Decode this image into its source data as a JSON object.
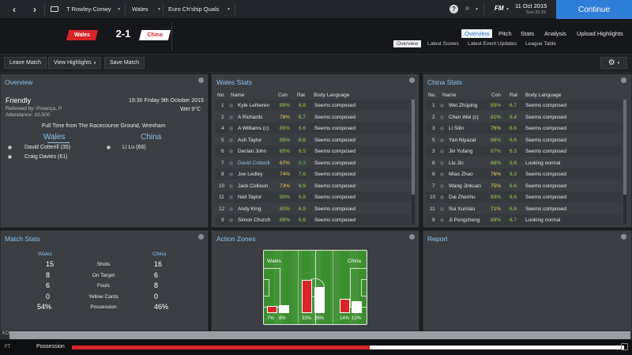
{
  "colors": {
    "accent": "#2f7fd8",
    "title_blue": "#8ec2f0",
    "wales_red": "#d9252a",
    "china_white": "#ffffff",
    "china_text": "#d9252a",
    "good": "#f0d84a",
    "pct_green": "#9fd44a",
    "very_good": "#5fc04a"
  },
  "topbar": {
    "back_icon": "chevron-left-icon",
    "forward_icon": "chevron-right-icon",
    "manager": "T Rowley-Conwy",
    "nation": "Wales",
    "competition": "Euro Ch'ship Quals",
    "date": "11 Oct 2015",
    "day_time": "Sun 21:15",
    "fm_label": "FM",
    "continue": "Continue"
  },
  "header": {
    "home_team": "Wales",
    "away_team": "China",
    "score": "2-1",
    "tabs": [
      "Overview",
      "Pitch",
      "Stats",
      "Analysis",
      "Upload Highlights"
    ],
    "active_tab": "Overview",
    "subtabs": [
      "Overview",
      "Latest Scores",
      "Latest Event Updates",
      "League Table"
    ],
    "active_subtab": "Overview"
  },
  "actionbar": {
    "leave": "Leave Match",
    "view_highlights": "View Highlights",
    "save": "Save Match"
  },
  "overview": {
    "title": "Overview",
    "type": "Friendly",
    "datetime": "19:30 Friday 9th October 2015",
    "referee": "Refereed by: Proença, P",
    "weather": "Wet 9°C",
    "attendance": "Attendance: 10,500",
    "fulltime": "Full Time from The Racecourse Ground, Wrexham",
    "home": "Wales",
    "away": "China",
    "home_scorers": [
      "David Cotterill (35)",
      "Craig Davies (61)"
    ],
    "away_scorers": [
      "Li Lu (66)"
    ]
  },
  "wales_stats": {
    "title": "Wales Stats",
    "headers": [
      "No.",
      "Name",
      "Con",
      "Rat",
      "Body Language"
    ],
    "rows": [
      [
        "1",
        "Kyle Letheren",
        "89%",
        "6.8",
        "Seems composed"
      ],
      [
        "2",
        "A Richards",
        "78%",
        "6.7",
        "Seems composed"
      ],
      [
        "4",
        "A Williams (c)",
        "88%",
        "6.6",
        "Seems composed"
      ],
      [
        "5",
        "Ash Taylor",
        "95%",
        "6.8",
        "Seems composed"
      ],
      [
        "6",
        "Declan John",
        "85%",
        "6.5",
        "Seems composed"
      ],
      [
        "7",
        "David Cotterill",
        "67%",
        "8.3",
        "Seems composed"
      ],
      [
        "8",
        "Joe Ledley",
        "74%",
        "7.6",
        "Seems composed"
      ],
      [
        "10",
        "Jack Collison",
        "73%",
        "6.9",
        "Seems composed"
      ],
      [
        "11",
        "Neil Taylor",
        "90%",
        "6.8",
        "Seems composed"
      ],
      [
        "12",
        "Andy King",
        "80%",
        "6.9",
        "Seems composed"
      ],
      [
        "9",
        "Simon Church",
        "89%",
        "6.6",
        "Seems composed"
      ]
    ]
  },
  "china_stats": {
    "title": "China Stats",
    "headers": [
      "No.",
      "Name",
      "Con",
      "Rat",
      "Body Language"
    ],
    "rows": [
      [
        "1",
        "Wei Zhüping",
        "85%",
        "6.7",
        "Seems composed"
      ],
      [
        "2",
        "Chen Wei (c)",
        "81%",
        "6.4",
        "Seems composed"
      ],
      [
        "3",
        "Li Silin",
        "76%",
        "6.6",
        "Seems composed"
      ],
      [
        "5",
        "Yan Niyazal",
        "86%",
        "6.6",
        "Seems composed"
      ],
      [
        "3",
        "Jin Yufang",
        "87%",
        "6.3",
        "Seems composed"
      ],
      [
        "6",
        "Liu Jin",
        "86%",
        "6.6",
        "Looking normal"
      ],
      [
        "8",
        "Miao Zhao",
        "76%",
        "6.3",
        "Seems composed"
      ],
      [
        "7",
        "Wang Jinkuan",
        "75%",
        "6.6",
        "Seems composed"
      ],
      [
        "10",
        "Dai Zhenhu",
        "93%",
        "6.6",
        "Seems composed"
      ],
      [
        "11",
        "Sui Xumiao",
        "71%",
        "6.8",
        "Seems composed"
      ],
      [
        "9",
        "Ji Pengcheng",
        "88%",
        "6.7",
        "Looking normal"
      ]
    ]
  },
  "match_stats": {
    "title": "Match Stats",
    "home": "Wales",
    "away": "China",
    "rows": [
      [
        "15",
        "Shots",
        "16"
      ],
      [
        "8",
        "On Target",
        "6"
      ],
      [
        "6",
        "Fouls",
        "8"
      ],
      [
        "0",
        "Yellow Cards",
        "0"
      ],
      [
        "54%",
        "Possession",
        "46%"
      ]
    ]
  },
  "action_zones": {
    "title": "Action Zones",
    "home": "Wales",
    "away": "China",
    "zones": [
      {
        "label": "7%",
        "value": 7,
        "color": "#d9252a"
      },
      {
        "label": "8%",
        "value": 8,
        "color": "#ffffff"
      },
      {
        "label": "33%",
        "value": 33,
        "color": "#d9252a"
      },
      {
        "label": "26%",
        "value": 26,
        "color": "#ffffff"
      },
      {
        "label": "14%",
        "value": 14,
        "color": "#d9252a"
      },
      {
        "label": "12%",
        "value": 12,
        "color": "#ffffff"
      }
    ]
  },
  "report": {
    "title": "Report"
  },
  "bottom": {
    "minute": "FT",
    "possession_label": "Possession",
    "home_possession": 0.54
  }
}
